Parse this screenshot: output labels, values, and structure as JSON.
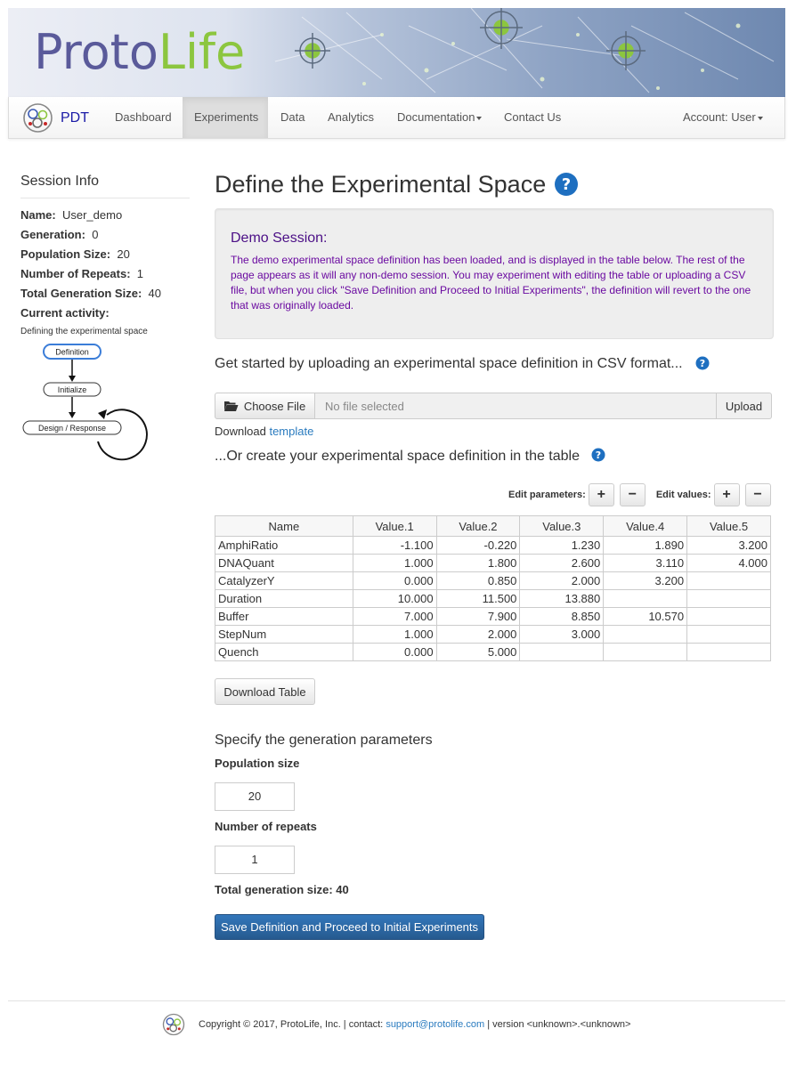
{
  "banner": {
    "logo_proto": "Proto",
    "logo_life": "Life"
  },
  "nav": {
    "brand": "PDT",
    "items": [
      {
        "label": "Dashboard"
      },
      {
        "label": "Experiments"
      },
      {
        "label": "Data"
      },
      {
        "label": "Analytics"
      },
      {
        "label": "Documentation"
      },
      {
        "label": "Contact Us"
      }
    ],
    "active": "Experiments",
    "account": "Account: User"
  },
  "sidebar": {
    "title": "Session Info",
    "name_label": "Name:",
    "name_value": "User_demo",
    "generation_label": "Generation:",
    "generation_value": "0",
    "population_label": "Population Size:",
    "population_value": "20",
    "repeats_label": "Number of Repeats:",
    "repeats_value": "1",
    "total_label": "Total Generation Size:",
    "total_value": "40",
    "activity_label": "Current activity:",
    "activity_value": "Defining the experimental space",
    "flow": {
      "step1": "Definition",
      "step2": "Initialize",
      "step3": "Design / Response"
    }
  },
  "main": {
    "title": "Define the Experimental Space",
    "demo_title": "Demo Session:",
    "demo_text": "The demo experimental space definition has been loaded, and is displayed in the table below. The rest of the page appears as it will any non-demo session. You may experiment with editing the table or uploading a CSV file, but when you click \"Save Definition and Proceed to Initial Experiments\", the definition will revert to the one that was originally loaded.",
    "upload_heading": "Get started by uploading an experimental space definition in CSV format...",
    "choose_file": "Choose File",
    "no_file": "No file selected",
    "upload": "Upload",
    "download_prefix": "Download",
    "download_link": "template",
    "table_heading": "...Or create your experimental space definition in the table",
    "edit_parameters": "Edit parameters:",
    "edit_values": "Edit values:",
    "plus": "+",
    "minus": "−",
    "table": {
      "headers": [
        "Name",
        "Value.1",
        "Value.2",
        "Value.3",
        "Value.4",
        "Value.5"
      ],
      "rows": [
        [
          "AmphiRatio",
          "-1.100",
          "-0.220",
          "1.230",
          "1.890",
          "3.200"
        ],
        [
          "DNAQuant",
          "1.000",
          "1.800",
          "2.600",
          "3.110",
          "4.000"
        ],
        [
          "CatalyzerY",
          "0.000",
          "0.850",
          "2.000",
          "3.200",
          ""
        ],
        [
          "Duration",
          "10.000",
          "11.500",
          "13.880",
          "",
          ""
        ],
        [
          "Buffer",
          "7.000",
          "7.900",
          "8.850",
          "10.570",
          ""
        ],
        [
          "StepNum",
          "1.000",
          "2.000",
          "3.000",
          "",
          ""
        ],
        [
          "Quench",
          "0.000",
          "5.000",
          "",
          "",
          ""
        ]
      ]
    },
    "download_table": "Download Table",
    "gen_heading": "Specify the generation parameters",
    "population_label": "Population size",
    "population_value": "20",
    "repeats_label": "Number of repeats",
    "repeats_value": "1",
    "total_text": "Total generation size: 40",
    "save_button": "Save Definition and Proceed to Initial Experiments"
  },
  "footer": {
    "copyright": "Copyright © 2017, ProtoLife, Inc. | contact:",
    "email": "support@protolife.com",
    "version": "| version <unknown>.<unknown>"
  },
  "colors": {
    "brand_blue": "#1a1aa6",
    "logo_purple": "#5a5a9a",
    "logo_green": "#8cc63f",
    "demo_text": "#6a0aa0",
    "link": "#2a7bbf",
    "primary": "#2f6ea8"
  }
}
